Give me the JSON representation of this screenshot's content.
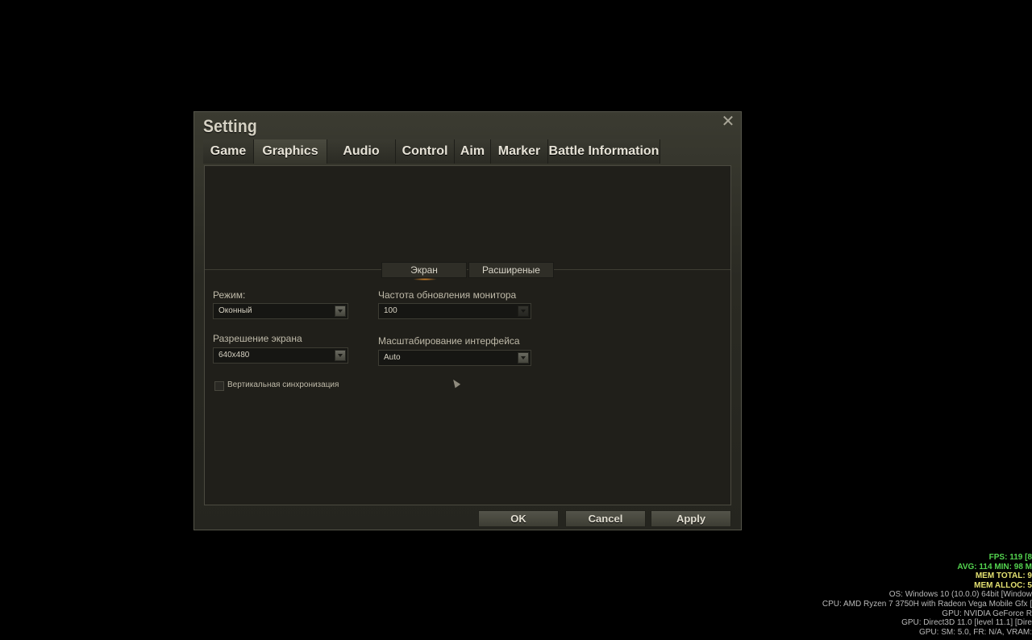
{
  "dialog": {
    "title": "Setting",
    "close_label": "✕",
    "tabs": [
      "Game",
      "Graphics",
      "Audio",
      "Control",
      "Aim",
      "Marker",
      "Battle Information"
    ],
    "active_tab": "Graphics"
  },
  "subtabs": [
    "Экран",
    "Расширеные"
  ],
  "active_subtab": "Экран",
  "fields": {
    "mode_label": "Режим:",
    "mode_value": "Оконный",
    "resolution_label": "Разрешение экрана",
    "resolution_value": "640x480",
    "refresh_label": "Частота обновления монитора",
    "refresh_value": "100",
    "scale_label": "Масштабирование интерфейса",
    "scale_value": "Auto",
    "vsync_label": "Вертикальная синхронизация",
    "vsync_checked": false
  },
  "buttons": {
    "ok": "OK",
    "cancel": "Cancel",
    "apply": "Apply"
  },
  "overlay": {
    "fps": "FPS: 119 [8",
    "avg": "AVG: 114 MIN: 98 M",
    "mem_total": "MEM TOTAL: 9",
    "mem_alloc": "MEM ALLOC: 5",
    "os": "OS: Windows 10  (10.0.0) 64bit [Window",
    "cpu": "CPU: AMD Ryzen 7 3750H with Radeon Vega Mobile Gfx  [",
    "gpu": "GPU: NVIDIA GeForce R",
    "gpu_api": "GPU: Direct3D 11.0 [level 11.1] [Dire",
    "gpu_sm": "GPU: SM: 5.0, FR: N/A, VRAM: "
  },
  "colors": {
    "overlay_green": "#53d34f",
    "overlay_yellow": "#e3e071",
    "accent_orange": "#e08a2a"
  }
}
